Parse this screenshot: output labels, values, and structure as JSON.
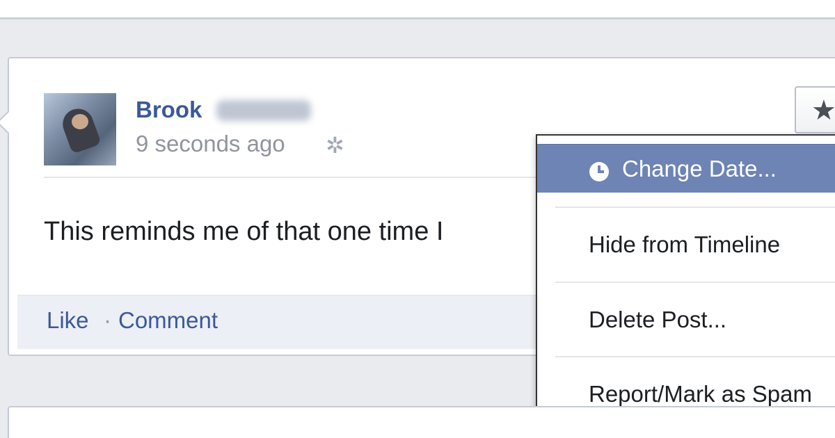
{
  "post": {
    "author_name": "Brook",
    "timestamp": "9 seconds ago",
    "audience_icon": "gear-icon",
    "text": "This reminds me of that one time I",
    "actions": {
      "like": "Like",
      "separator": "·",
      "comment": "Comment"
    }
  },
  "star_button": {
    "icon": "star-icon",
    "glyph": "★"
  },
  "menu": {
    "items": [
      {
        "label": "Change Date...",
        "icon": "clock-icon",
        "active": true
      },
      {
        "label": "Hide from Timeline"
      },
      {
        "label": "Delete Post..."
      },
      {
        "label": "Report/Mark as Spam"
      }
    ]
  },
  "colors": {
    "link_blue": "#3b5998",
    "menu_highlight": "#6d84b4",
    "page_background": "#e9ebee"
  }
}
